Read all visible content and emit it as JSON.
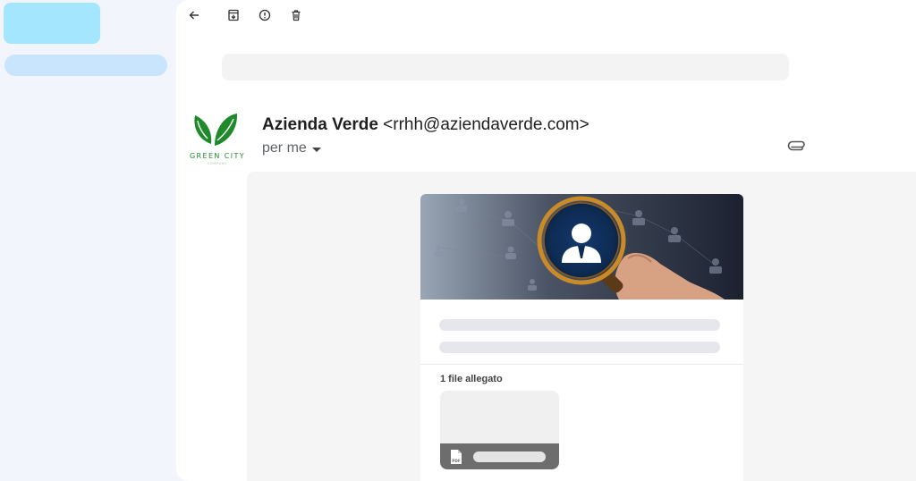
{
  "toolbar": {
    "back_icon": "arrow-left-icon",
    "archive_icon": "archive-icon",
    "spam_icon": "report-spam-icon",
    "delete_icon": "trash-icon"
  },
  "message": {
    "sender_name": "Azienda Verde",
    "sender_email": "<rrhh@aziendaverde.com>",
    "recipient": "per me",
    "logo_text": "GREEN CITY",
    "logo_subtext": "COMPANY",
    "attachment_icon": "paperclip-icon"
  },
  "card": {
    "attachment_count_label": "1 file allegato",
    "file_type": "PDF"
  },
  "colors": {
    "brand_green": "#1f8a2a",
    "sidebar_bg": "#f2f5fb",
    "compose_skeleton": "#a3e6fe",
    "nav_skeleton": "#c9e4fd"
  }
}
